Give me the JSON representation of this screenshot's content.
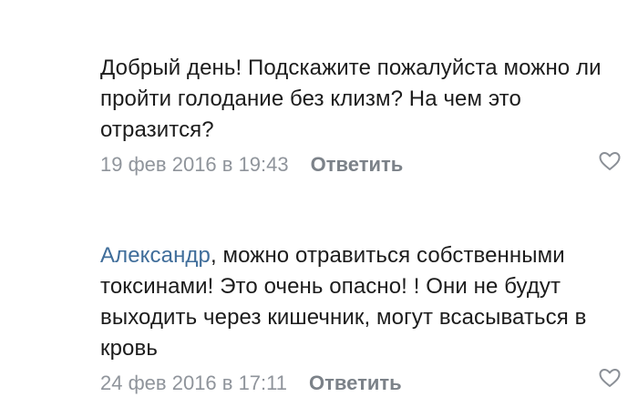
{
  "comments": [
    {
      "text": "Добрый день! Подскажите пожалуйста можно ли пройти голодание без клизм? На чем это отразится?",
      "date": "19 фев 2016 в 19:43",
      "reply_label": "Ответить",
      "like_icon": "heart-outline-icon"
    },
    {
      "author": "Александр",
      "text": ",  можно отравиться собственными токсинами! Это очень опасно! ! Они не будут выходить через кишечник, могут всасываться в кровь",
      "date": "24 фев 2016 в 17:11",
      "reply_label": "Ответить",
      "like_icon": "heart-outline-icon"
    }
  ],
  "colors": {
    "author_link": "#3f6d9a",
    "meta_text": "#8a8f96",
    "body_text": "#1c1c1c"
  }
}
